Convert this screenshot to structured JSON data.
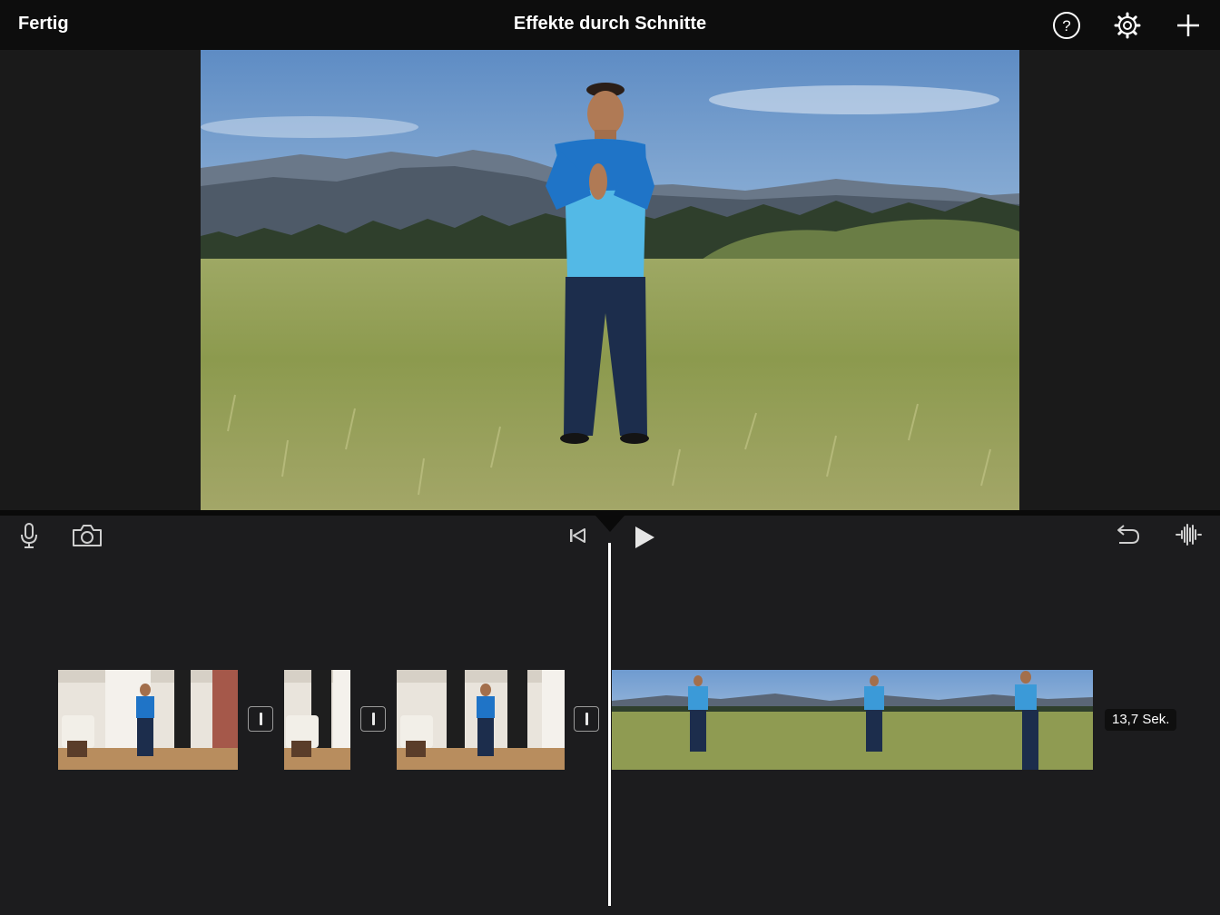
{
  "topbar": {
    "done_label": "Fertig",
    "title": "Effekte durch Schnitte",
    "icons": [
      "help-icon",
      "settings-gear-icon",
      "plus-icon"
    ]
  },
  "toolbar": {
    "left_icons": [
      "microphone-icon",
      "camera-icon"
    ],
    "center_icons": [
      "skip-to-start-icon",
      "play-icon"
    ],
    "right_icons": [
      "undo-icon",
      "audio-waveform-icon"
    ]
  },
  "timeline": {
    "clips": [
      {
        "scene": "indoor-living-room"
      },
      {
        "scene": "indoor-living-room"
      },
      {
        "scene": "indoor-living-room"
      },
      {
        "scene": "outdoor-meadow",
        "selected": false
      }
    ],
    "transitions": 3,
    "duration_label": "13,7 Sek."
  },
  "colors": {
    "background": "#1c1c1e",
    "topbar": "#0d0d0d",
    "playhead": "#ffffff"
  }
}
